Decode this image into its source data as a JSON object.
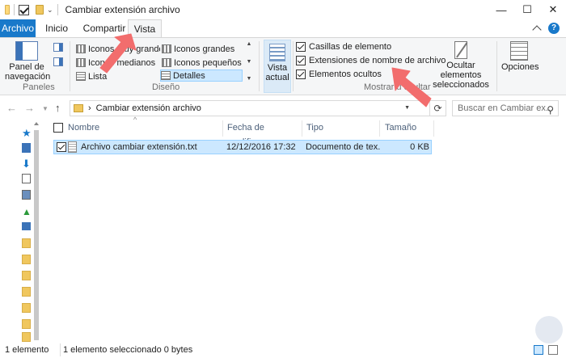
{
  "window": {
    "title": "Cambiar extensión archivo",
    "controls": {
      "minimize": "—",
      "maximize": "☐",
      "close": "✕"
    }
  },
  "tabs": [
    {
      "label": "Archivo"
    },
    {
      "label": "Inicio"
    },
    {
      "label": "Compartir"
    },
    {
      "label": "Vista"
    }
  ],
  "ribbon": {
    "paneles": {
      "nav_pane_label": "Panel de navegación",
      "group_label": "Paneles"
    },
    "diseno": {
      "items": [
        {
          "label": "Iconos muy grandes"
        },
        {
          "label": "Iconos grandes"
        },
        {
          "label": "Iconos medianos"
        },
        {
          "label": "Iconos pequeños"
        },
        {
          "label": "Lista"
        },
        {
          "label": "Detalles"
        }
      ],
      "selected": "Detalles",
      "group_label": "Diseño"
    },
    "vista_actual": {
      "label": "Vista actual"
    },
    "mostrar": {
      "checkboxes": [
        {
          "label": "Casillas de elemento",
          "checked": true
        },
        {
          "label": "Extensiones de nombre de archivo",
          "checked": true
        },
        {
          "label": "Elementos ocultos",
          "checked": true
        }
      ],
      "group_label": "Mostrar u ocultar"
    },
    "ocultar": {
      "label": "Ocultar elementos seleccionados"
    },
    "opciones": {
      "label": "Opciones"
    }
  },
  "address": {
    "path": "Cambiar extensión archivo",
    "separator": "›",
    "search_placeholder": "Buscar en Cambiar ex..."
  },
  "columns": {
    "name": "Nombre",
    "date": "Fecha de modifica...",
    "type": "Tipo",
    "size": "Tamaño"
  },
  "files": [
    {
      "name": "Archivo cambiar extensión.txt",
      "date": "12/12/2016 17:32",
      "type": "Documento de tex...",
      "size": "0 KB",
      "selected": true,
      "checked": true
    }
  ],
  "status": {
    "count": "1 elemento",
    "selected": "1 elemento seleccionado 0 bytes"
  },
  "colors": {
    "accent": "#1979ca",
    "selection": "#cce8ff",
    "arrow": "#f26d6d"
  }
}
